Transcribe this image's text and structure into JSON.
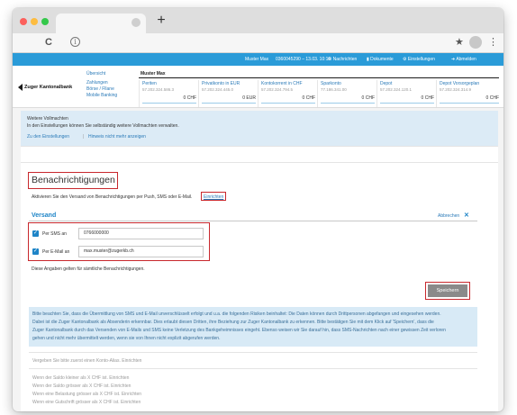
{
  "browser": {
    "new_tab_symbol": "+",
    "back_icon": "C",
    "info_icon": "i",
    "star_icon": "★",
    "menu_icon": "⋮"
  },
  "topbar": {
    "user": "Muster Max",
    "session": "0360045290 – 13.03. 10:16",
    "messages": "Nachrichten",
    "documents": "Dokumente",
    "settings": "Einstellungen",
    "logout": "Abmelden"
  },
  "header": {
    "bank_name": "Zuger Kantonalbank",
    "nav": [
      "Übersicht",
      "Zahlungen",
      "Börse / Fllane",
      "Mobile Banking"
    ],
    "owner": "Muster Max",
    "accounts": [
      {
        "name": "Periten",
        "number": "57.202.324.586.3",
        "balance": "0 CHF"
      },
      {
        "name": "Privatkonto in EUR",
        "number": "57.202.324.445.0",
        "balance": "0 EUR"
      },
      {
        "name": "Kontokorrent in CHF",
        "number": "57.202.324.794.5",
        "balance": "0 CHF"
      },
      {
        "name": "Sparkonto",
        "number": "77.186.341.00",
        "balance": "0 CHF"
      },
      {
        "name": "Depot",
        "number": "57.202.324.120.1",
        "balance": "0 CHF"
      },
      {
        "name": "Depot Vorsorgeplan",
        "number": "57.202.324.314.9",
        "balance": "0 CHF"
      }
    ]
  },
  "vollmachten": {
    "title": "Weitere Vollmachten",
    "text": "In den Einstellungen können Sie selbständig weitere Vollmachten verwalten.",
    "link_settings": "Zu den Einstellungen",
    "separator": "|",
    "link_hide": "Hinweis nicht mehr anzeigen"
  },
  "benachrichtigungen": {
    "title": "Benachrichtigungen",
    "intro": "Aktivieren Sie den Versand von Benachrichtigungen per Push, SMS oder E-Mail.",
    "setup_link": "Einrichten"
  },
  "versand": {
    "title": "Versand",
    "cancel": "Abbrechen",
    "cancel_icon": "✕",
    "sms_label": "Per SMS an",
    "sms_value": "0766000000",
    "email_label": "Per E-Mail an",
    "email_value": "max.muster@zugerkb.ch",
    "hint": "Diese Angaben gelten für sämtliche Benachrichtigungen.",
    "save": "Speichern"
  },
  "disclaimer": [
    "Bitte beachten Sie, dass die Übermittlung von SMS und E-Mail unverschlüsselt erfolgt und u.a. die folgenden Risiken beinhaltet: Die Daten können durch Drittpersonen abgefangen und eingesehen werden.",
    "Dabei ist die Zuger Kantonalbank als Absenderin erkennbar. Dies erlaubt diesen Dritten, ihre Beziehung zur Zuger Kantonalbank zu erkennen. Bitte bestätigen Sie mit dem Klick auf 'Speichern', dass die",
    "Zuger Kantonalbank durch das Versenden von E-Mails und SMS keine Verletzung des Bankgeheimnisses eingeht. Ebenso weisen wir Sie darauf hin, dass SMS-Nachrichten nach einer gewissen Zeit verloren",
    "gehen und nicht mehr übermittelt werden, wenn sie von Ihnen nicht explizit abgerufen werden."
  ],
  "rules": {
    "intro": "Vergeben Sie bitte zuerst einen Konto-Alias. Einrichten",
    "items": [
      "Wenn der Saldo kleiner als X CHF ist. Einrichten",
      "Wenn der Saldo grösser als X CHF ist. Einrichten",
      "Wenn eine Belastung grösser als X CHF ist. Einrichten",
      "Wenn eine Gutschrift grösser als X CHF ist. Einrichten"
    ]
  }
}
